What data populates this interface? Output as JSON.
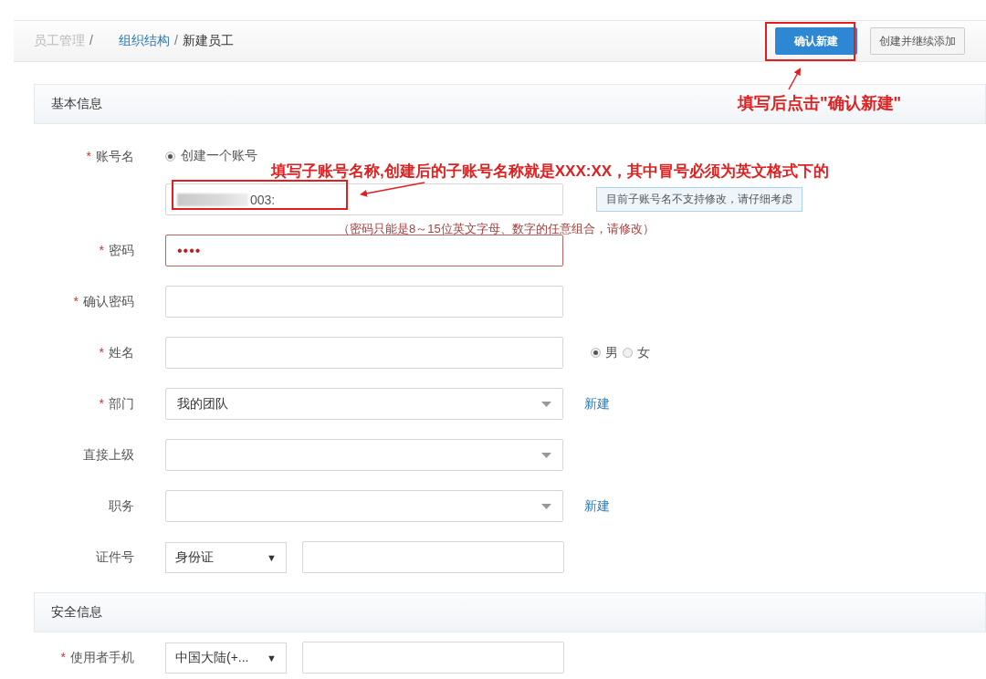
{
  "breadcrumb": {
    "separator": "/",
    "items": [
      {
        "label": "员工管理",
        "kind": "muted"
      },
      {
        "label": "组织结构",
        "kind": "link"
      },
      {
        "label": "新建员工",
        "kind": "current"
      }
    ]
  },
  "actions": [
    {
      "label": "确认新建",
      "primary": true
    },
    {
      "label": "创建并继续添加",
      "primary": false
    }
  ],
  "sections": [
    {
      "title": "基本信息",
      "fields": [
        {
          "label": "账号名",
          "mark": "*",
          "kind": "account",
          "radio": {
            "label": "创建一个账号",
            "selected": true
          },
          "value": "003:",
          "hint": "目前子账号名不支持修改，请仔细考虑"
        },
        {
          "label": "密码",
          "mark": "*",
          "kind": "text",
          "value": "••••",
          "error": true,
          "error_text": "（密码只能是8～15位英文字母、数字的任意组合，请修改）"
        },
        {
          "label": "确认密码",
          "mark": "*",
          "kind": "text",
          "error": false
        },
        {
          "label": "姓名",
          "mark": "*",
          "kind": "text",
          "error": false,
          "options": [
            {
              "label": "男",
              "selected": true
            },
            {
              "label": "女",
              "selected": false
            }
          ]
        },
        {
          "label": "部门",
          "mark": "*",
          "kind": "select",
          "value": "我的团队",
          "link": "新建"
        },
        {
          "label": "直接上级",
          "kind": "select"
        },
        {
          "label": "职务",
          "kind": "select",
          "link": "新建"
        },
        {
          "label": "证件号",
          "kind": "combo",
          "select": "身份证",
          "arrow": "▼"
        }
      ]
    },
    {
      "title": "安全信息",
      "fields": [
        {
          "label": "使用者手机",
          "mark": "*",
          "kind": "combo",
          "select": "中国大陆(+...",
          "arrow": "▼"
        }
      ]
    }
  ],
  "annotations": [
    {
      "text": "填写后点击\"确认新建\""
    },
    {
      "text": "填写子账号名称,创建后的子账号名称就是XXX:XX，其中冒号必须为英文格式下的"
    }
  ]
}
